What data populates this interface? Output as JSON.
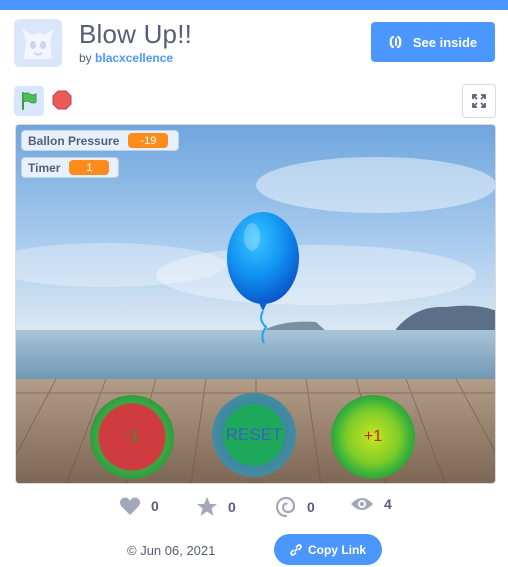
{
  "project": {
    "title": "Blow Up!!",
    "by_prefix": "by",
    "author": "blacxcellence"
  },
  "header": {
    "see_inside_label": "See inside"
  },
  "controls": {
    "green_flag": "green-flag-icon",
    "stop": "stop-icon",
    "fullscreen": "fullscreen-icon"
  },
  "stage": {
    "monitors": [
      {
        "label": "Ballon Pressure",
        "value": "-19"
      },
      {
        "label": "Timer",
        "value": "1"
      }
    ],
    "buttons": {
      "minus_label": "-1",
      "reset_label": "RESET",
      "plus_label": "+1"
    }
  },
  "stats": {
    "loves": "0",
    "favorites": "0",
    "remixes": "0",
    "views": "4"
  },
  "footer": {
    "date": "© Jun 06, 2021",
    "copy_link_label": "Copy Link"
  },
  "colors": {
    "accent": "#4c97ff",
    "monitor_value": "#ff8c1a",
    "text": "#575e75"
  }
}
